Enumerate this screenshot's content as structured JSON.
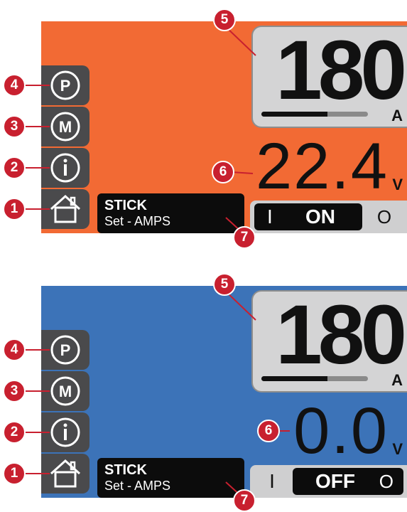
{
  "screen_on": {
    "current": {
      "value": "180",
      "unit": "A",
      "level": 0.62
    },
    "voltage": {
      "value": "22.4",
      "unit": "V"
    },
    "mode": {
      "process": "STICK",
      "setting": "Set - AMPS"
    },
    "output": {
      "on_mark": "I",
      "state": "ON",
      "off_mark": "O"
    },
    "background": "#f26a34"
  },
  "screen_off": {
    "current": {
      "value": "180",
      "unit": "A",
      "level": 0.62
    },
    "voltage": {
      "value": "0.0",
      "unit": "V"
    },
    "mode": {
      "process": "STICK",
      "setting": "Set - AMPS"
    },
    "output": {
      "on_mark": "I",
      "state": "OFF",
      "off_mark": "O"
    },
    "background": "#3c73b8"
  },
  "sidebar_icons": [
    "program-icon",
    "memory-icon",
    "info-icon",
    "home-icon"
  ],
  "callouts": {
    "n1": "1",
    "n2": "2",
    "n3": "3",
    "n4": "4",
    "n5": "5",
    "n6": "6",
    "n7": "7"
  },
  "callout_color": "#c8202f"
}
